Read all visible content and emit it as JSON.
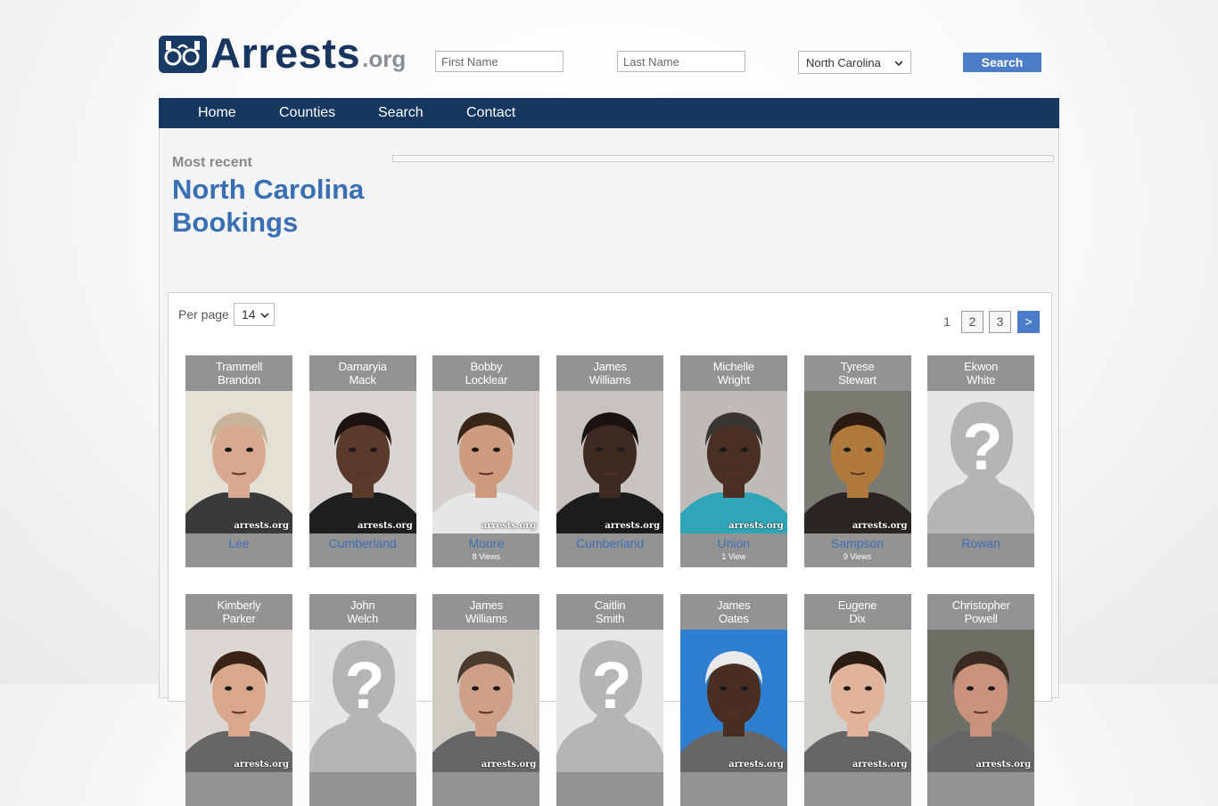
{
  "brand": {
    "name": "Arrests",
    "tld": ".org"
  },
  "search": {
    "first_placeholder": "First Name",
    "last_placeholder": "Last Name",
    "state_value": "North Carolina",
    "button_label": "Search"
  },
  "nav": {
    "items": [
      "Home",
      "Counties",
      "Search",
      "Contact"
    ]
  },
  "page": {
    "kicker": "Most recent",
    "title": "North Carolina Bookings"
  },
  "listing": {
    "per_page_label": "Per page",
    "per_page_value": "14",
    "pagination": {
      "current": "1",
      "pages": [
        "2",
        "3"
      ],
      "next": ">"
    }
  },
  "watermark_text": "arrests.org",
  "bookings": [
    {
      "first": "Trammell",
      "last": "Brandon",
      "county": "Lee",
      "views": "",
      "photo": "mugshot"
    },
    {
      "first": "Damaryia",
      "last": "Mack",
      "county": "Cumberland",
      "views": "",
      "photo": "mugshot"
    },
    {
      "first": "Bobby",
      "last": "Locklear",
      "county": "Moore",
      "views": "8 Views",
      "photo": "mugshot"
    },
    {
      "first": "James",
      "last": "Williams",
      "county": "Cumberland",
      "views": "",
      "photo": "mugshot"
    },
    {
      "first": "Michelle",
      "last": "Wright",
      "county": "Union",
      "views": "1 View",
      "photo": "mugshot"
    },
    {
      "first": "Tyrese",
      "last": "Stewart",
      "county": "Sampson",
      "views": "9 Views",
      "photo": "mugshot"
    },
    {
      "first": "Ekwon",
      "last": "White",
      "county": "Rowan",
      "views": "",
      "photo": "placeholder"
    },
    {
      "first": "Kimberly",
      "last": "Parker",
      "county": "",
      "views": "",
      "photo": "mugshot"
    },
    {
      "first": "John",
      "last": "Welch",
      "county": "",
      "views": "",
      "photo": "placeholder"
    },
    {
      "first": "James",
      "last": "Williams",
      "county": "",
      "views": "",
      "photo": "mugshot"
    },
    {
      "first": "Caitlin",
      "last": "Smith",
      "county": "",
      "views": "",
      "photo": "placeholder"
    },
    {
      "first": "James",
      "last": "Oates",
      "county": "",
      "views": "",
      "photo": "mugshot"
    },
    {
      "first": "Eugene",
      "last": "Dix",
      "county": "",
      "views": "",
      "photo": "mugshot"
    },
    {
      "first": "Christopher",
      "last": "Powell",
      "county": "",
      "views": "",
      "photo": "mugshot"
    }
  ],
  "colors": {
    "nav": "#14365f",
    "accent": "#4b7cc7",
    "link": "#3e6fb8",
    "card": "#939393"
  },
  "icons": {
    "logo": "handcuffs-badge-icon",
    "missing_photo": "unknown-person-icon"
  }
}
